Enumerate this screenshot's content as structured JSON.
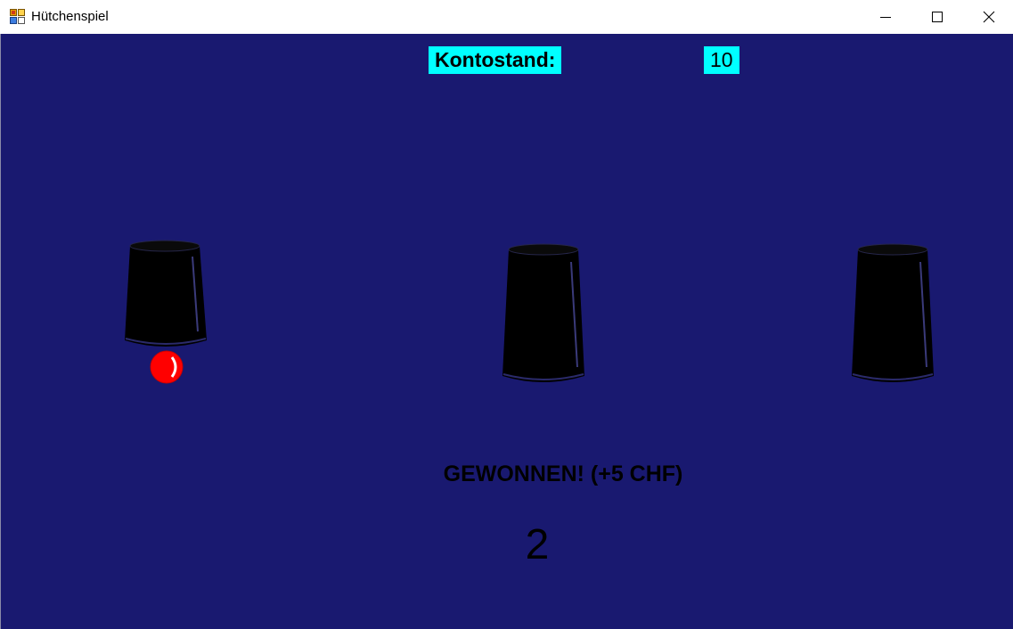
{
  "window": {
    "title": "Hütchenspiel",
    "background_color": "#191970"
  },
  "balance": {
    "label": "Kontostand:",
    "value": "10",
    "highlight_color": "#00ffff"
  },
  "cups": [
    {
      "id": 1,
      "lifted": true
    },
    {
      "id": 2,
      "lifted": false
    },
    {
      "id": 3,
      "lifted": false
    }
  ],
  "ball": {
    "under_cup": 1,
    "color": "#ff0000"
  },
  "result": {
    "message": "GEWONNEN! (+5 CHF)"
  },
  "round": {
    "number": "2"
  },
  "icons": {
    "app": "app-icon",
    "minimize": "minimize-icon",
    "maximize": "maximize-icon",
    "close": "close-icon"
  }
}
